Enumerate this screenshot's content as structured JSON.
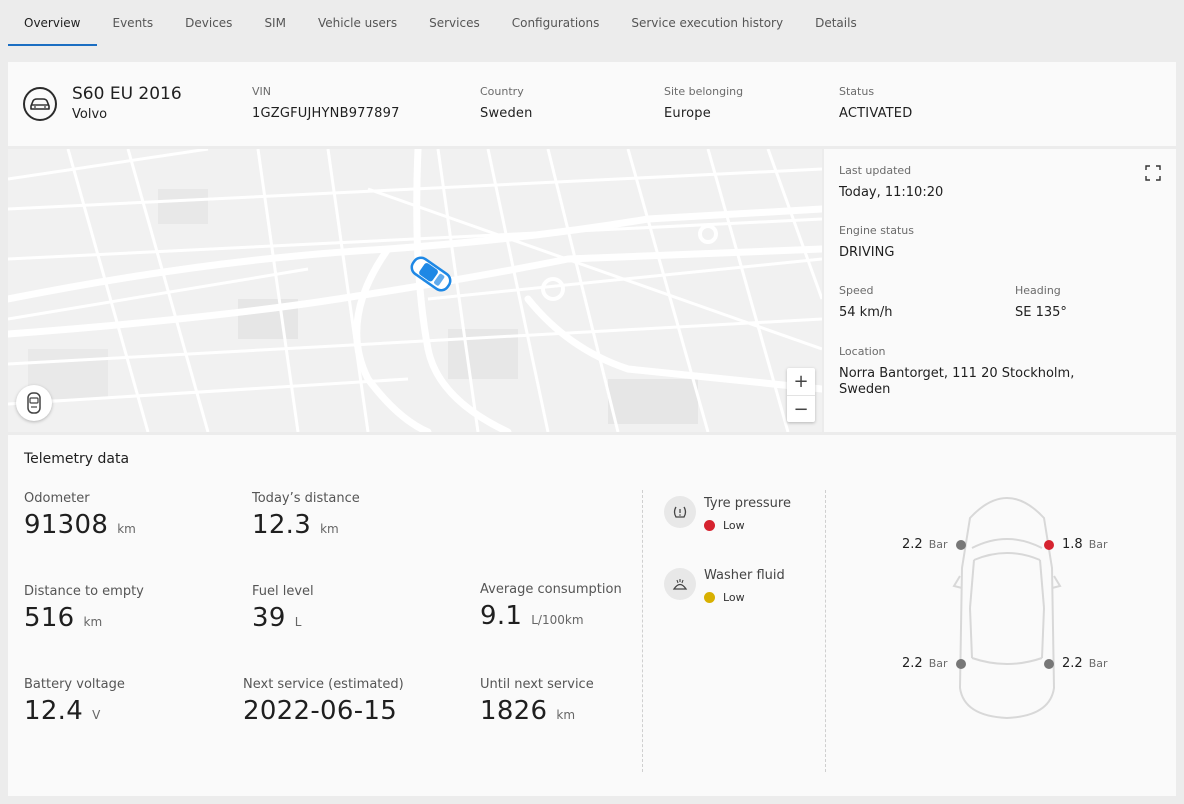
{
  "tabs": [
    "Overview",
    "Events",
    "Devices",
    "SIM",
    "Vehicle users",
    "Services",
    "Configurations",
    "Service execution history",
    "Details"
  ],
  "vehicle": {
    "model": "S60 EU 2016",
    "brand": "Volvo",
    "vin_label": "VIN",
    "vin": "1GZGFUJHYNB977897",
    "country_label": "Country",
    "country": "Sweden",
    "site_label": "Site belonging",
    "site": "Europe",
    "status_label": "Status",
    "status": "ACTIVATED"
  },
  "map": {
    "zoom_in": "+",
    "zoom_out": "−",
    "locate_icon": "car-front-icon",
    "expand_icon": "fullscreen-icon"
  },
  "info": {
    "last_updated_label": "Last updated",
    "last_updated": "Today, 11:10:20",
    "engine_label": "Engine status",
    "engine": "DRIVING",
    "speed_label": "Speed",
    "speed": "54 km/h",
    "heading_label": "Heading",
    "heading": "SE 135°",
    "location_label": "Location",
    "location_line1": "Norra Bantorget, 111 20 Stockholm,",
    "location_line2": "Sweden"
  },
  "telemetry": {
    "title": "Telemetry data",
    "odometer": {
      "label": "Odometer",
      "value": "91308",
      "unit": "km"
    },
    "todays_distance": {
      "label": "Today’s distance",
      "value": "12.3",
      "unit": "km"
    },
    "distance_to_empty": {
      "label": "Distance to empty",
      "value": "516",
      "unit": "km"
    },
    "fuel_level": {
      "label": "Fuel level",
      "value": "39",
      "unit": "L"
    },
    "avg_consumption": {
      "label": "Average consumption",
      "value": "9.1",
      "unit": "L/100km"
    },
    "battery_voltage": {
      "label": "Battery voltage",
      "value": "12.4",
      "unit": "V"
    },
    "next_service": {
      "label": "Next service (estimated)",
      "value": "2022-06-15"
    },
    "until_next_service": {
      "label": "Until next service",
      "value": "1826",
      "unit": "km"
    }
  },
  "alerts": {
    "tyre": {
      "label": "Tyre pressure",
      "status": "Low",
      "color": "#d6232f"
    },
    "washer": {
      "label": "Washer fluid",
      "status": "Low",
      "color": "#d8b000"
    }
  },
  "tyres": {
    "unit": "Bar",
    "front_left": {
      "value": "2.2",
      "color": "#777777"
    },
    "front_right": {
      "value": "1.8",
      "color": "#d6232f"
    },
    "rear_left": {
      "value": "2.2",
      "color": "#777777"
    },
    "rear_right": {
      "value": "2.2",
      "color": "#777777"
    }
  },
  "colors": {
    "accent": "#1b6ec2",
    "alert_red": "#d6232f",
    "alert_yellow": "#d8b000",
    "car_marker": "#1e88e5"
  }
}
